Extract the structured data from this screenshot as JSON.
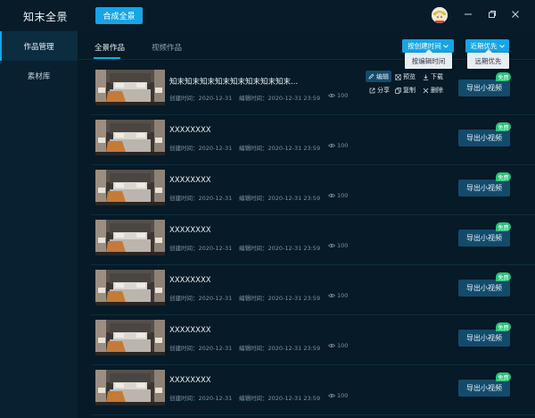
{
  "app": {
    "logo": "知末全景",
    "compose_label": "合成全景"
  },
  "window_controls": [
    "minimize-icon",
    "restore-icon",
    "close-icon"
  ],
  "sidebar": {
    "items": [
      {
        "label": "作品管理",
        "active": true
      },
      {
        "label": "素材库",
        "active": false
      }
    ]
  },
  "tabs": [
    {
      "label": "全景作品",
      "active": true
    },
    {
      "label": "视频作品",
      "active": false
    }
  ],
  "sort": {
    "time": {
      "label": "按创建时间",
      "option": "按编辑时间"
    },
    "priority": {
      "label": "近期优先",
      "option": "远期优先"
    }
  },
  "actions": {
    "edit": "编辑",
    "preview": "预览",
    "download": "下载",
    "share": "分享",
    "copy": "复制",
    "delete": "删除"
  },
  "rows": [
    {
      "title": "知末知末知末知末知末知末知末知末...",
      "created": "创建时间：2020-12-31",
      "edited": "编辑时间：2020-12-31  23:59",
      "views": "100",
      "export": "导出小视频",
      "badge": "免费"
    },
    {
      "title": "XXXXXXXX",
      "created": "创建时间：2020-12-31",
      "edited": "编辑时间：2020-12-31  23:59",
      "views": "100",
      "export": "导出小视频",
      "badge": "免费"
    },
    {
      "title": "XXXXXXXX",
      "created": "创建时间：2020-12-31",
      "edited": "编辑时间：2020-12-31  23:59",
      "views": "100",
      "export": "导出小视频",
      "badge": "免费"
    },
    {
      "title": "XXXXXXXX",
      "created": "创建时间：2020-12-31",
      "edited": "编辑时间：2020-12-31  23:59",
      "views": "100",
      "export": "导出小视频",
      "badge": "免费"
    },
    {
      "title": "XXXXXXXX",
      "created": "创建时间：2020-12-31",
      "edited": "编辑时间：2020-12-31  23:59",
      "views": "100",
      "export": "导出小视频",
      "badge": "免费"
    },
    {
      "title": "XXXXXXXX",
      "created": "创建时间：2020-12-31",
      "edited": "编辑时间：2020-12-31  23:59",
      "views": "100",
      "export": "导出小视频",
      "badge": "免费"
    },
    {
      "title": "XXXXXXXX",
      "created": "创建时间：2020-12-31",
      "edited": "编辑时间：2020-12-31  23:59",
      "views": "100",
      "export": "导出小视频",
      "badge": "免费"
    }
  ],
  "colors": {
    "accent": "#16a5e6",
    "background": "#061a27",
    "sidebar": "#08202f",
    "export": "#134b6b",
    "badge": "#2bc27a"
  }
}
